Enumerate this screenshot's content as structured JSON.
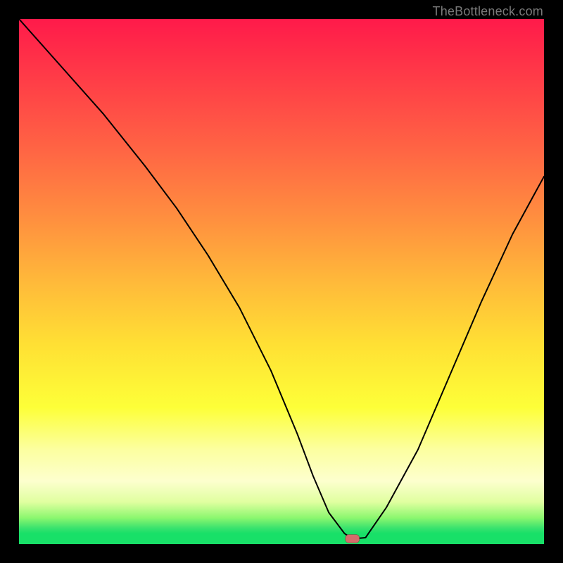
{
  "watermark": "TheBottleneck.com",
  "chart_data": {
    "type": "line",
    "title": "",
    "xlabel": "",
    "ylabel": "",
    "xlim": [
      0,
      100
    ],
    "ylim": [
      0,
      100
    ],
    "series": [
      {
        "name": "bottleneck-curve",
        "x": [
          0,
          8,
          16,
          24,
          30,
          36,
          42,
          48,
          53,
          56,
          59,
          62,
          63.5,
          66,
          70,
          76,
          82,
          88,
          94,
          100
        ],
        "y": [
          100,
          91,
          82,
          72,
          64,
          55,
          45,
          33,
          21,
          13,
          6,
          2,
          1,
          1.2,
          7,
          18,
          32,
          46,
          59,
          70
        ]
      }
    ],
    "marker": {
      "x": 63.5,
      "y": 1
    },
    "gradient_stops": [
      {
        "pos": 0,
        "color": "#ff1a4a"
      },
      {
        "pos": 12,
        "color": "#ff3e47"
      },
      {
        "pos": 25,
        "color": "#ff6544"
      },
      {
        "pos": 38,
        "color": "#ff8f3f"
      },
      {
        "pos": 50,
        "color": "#ffb93a"
      },
      {
        "pos": 62,
        "color": "#ffe034"
      },
      {
        "pos": 74,
        "color": "#fdff38"
      },
      {
        "pos": 82,
        "color": "#fcffa0"
      },
      {
        "pos": 88,
        "color": "#fdffce"
      },
      {
        "pos": 92,
        "color": "#e0ffa0"
      },
      {
        "pos": 95,
        "color": "#8cf76f"
      },
      {
        "pos": 97,
        "color": "#38e26e"
      },
      {
        "pos": 100,
        "color": "#18e068"
      }
    ]
  }
}
